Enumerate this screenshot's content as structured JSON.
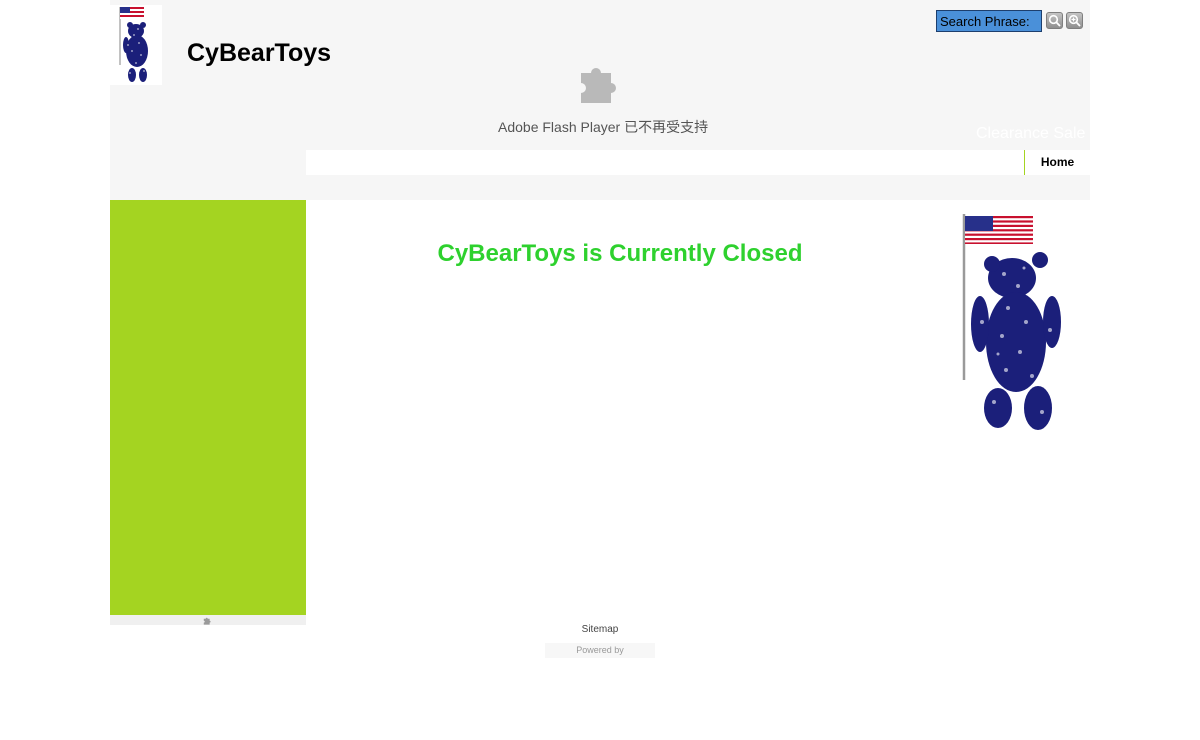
{
  "header": {
    "site_title": "CyBearToys",
    "search": {
      "placeholder": "Search Phrase:"
    },
    "search_button_icon": "magnifier-icon",
    "advanced_search_button_icon": "magnifier-plus-icon",
    "flash_notice": "Adobe Flash Player 已不再受支持",
    "marquee": "Clearance Sale"
  },
  "nav": {
    "items": [
      {
        "label": "Home"
      }
    ]
  },
  "main": {
    "heading": "CyBearToys is Currently Closed"
  },
  "footer": {
    "sitemap": "Sitemap",
    "powered_by": "Powered by"
  },
  "colors": {
    "accent_green": "#a4d421",
    "heading_green": "#2ed12e",
    "header_bg": "#f6f6f6",
    "search_bg": "#4a90d9",
    "bear_navy": "#1b1f7a"
  }
}
